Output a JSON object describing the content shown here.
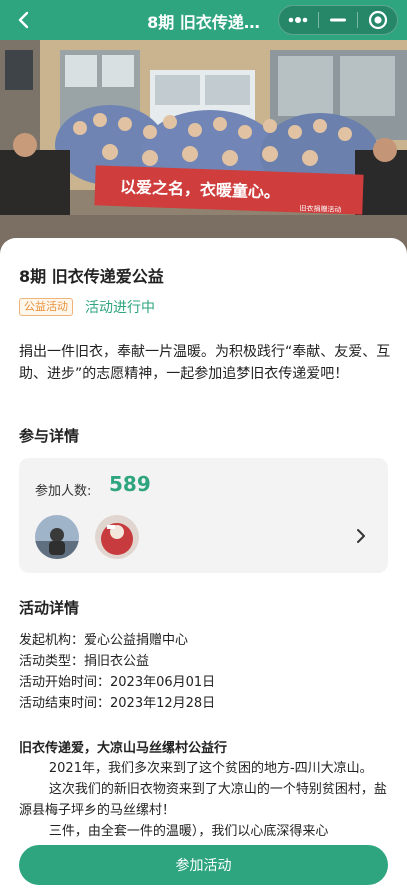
{
  "nav": {
    "title": "8期 旧衣传递…"
  },
  "hero": {
    "banner_text": "以爱之名，衣暖童心。",
    "banner_sub": "旧衣捐赠活动"
  },
  "activity": {
    "title": "8期 旧衣传递爱公益",
    "tag": "公益活动",
    "status": "活动进行中",
    "description": "捐出一件旧衣，奉献一片温暖。为积极践行“奉献、友爱、互助、进步”的志愿精神，一起参加追梦旧衣传递爱吧！"
  },
  "participation": {
    "section_title": "参与详情",
    "count_label": "参加人数:",
    "count_value": "589",
    "avatars": [
      "avatar-icon",
      "avatar-icon"
    ]
  },
  "details": {
    "section_title": "活动详情",
    "rows": [
      "发起机构：爱心公益捐赠中心",
      "活动类型：捐旧衣公益",
      "活动开始时间：2023年06月01日",
      "活动结束时间：2023年12月28日"
    ],
    "story_title": "旧衣传递爱，大凉山马丝缧村公益行",
    "paragraphs": [
      "2021年，我们多次来到了这个贫困的地方-四川大凉山。",
      "这次我们的新旧衣物资来到了大凉山的一个特别贫困村，盐源县梅子坪乡的马丝缧村！",
      "三件，由全套一件的温暖），我们以心底深得来心"
    ]
  },
  "join_button": "参加活动",
  "colors": {
    "primary": "#2ea57f",
    "tag": "#e8923b"
  }
}
